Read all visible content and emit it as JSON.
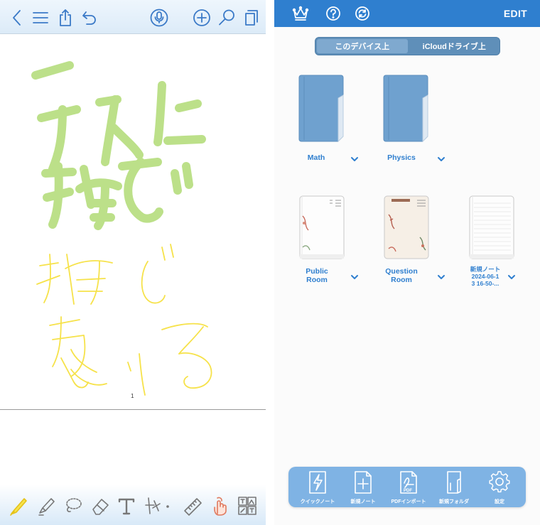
{
  "editor": {
    "toolbar_icons": [
      "back-chevron-icon",
      "menu-icon",
      "share-icon",
      "undo-icon",
      "microphone-icon",
      "add-icon",
      "search-icon",
      "pages-icon"
    ],
    "page_number": "1",
    "handwriting_colors": {
      "highlighter": "#b5dd7d",
      "pen": "#f6e24a"
    },
    "pen_tools": [
      "highlighter-icon",
      "marker-icon",
      "lasso-icon",
      "eraser-icon",
      "text-tool-icon",
      "laser-pointer-icon",
      "ruler-icon",
      "hand-tool-icon",
      "layout-icon"
    ]
  },
  "library": {
    "header": {
      "edit_label": "EDIT",
      "icons": [
        "crown-icon",
        "help-icon",
        "sync-icon"
      ]
    },
    "tabs": [
      {
        "label": "このデバイス上",
        "active": true
      },
      {
        "label": "iCloudドライブ上",
        "active": false
      }
    ],
    "folders": [
      {
        "name": "Math"
      },
      {
        "name": "Physics"
      }
    ],
    "notebooks": [
      {
        "name": "Public Room",
        "line1": "Public",
        "line2": "Room"
      },
      {
        "name": "Question Room",
        "line1": "Question",
        "line2": "Room"
      },
      {
        "name": "新規ノート 2024-06-13 16-50-...",
        "line1": "新規ノート",
        "line2": "2024-06-1",
        "line3": "3 16-50-..."
      }
    ],
    "bottom_bar": [
      {
        "label": "クイックノート",
        "icon": "quick-note-icon"
      },
      {
        "label": "新規ノート",
        "icon": "new-note-icon"
      },
      {
        "label": "PDFインポート",
        "icon": "pdf-import-icon"
      },
      {
        "label": "新規フォルダ",
        "icon": "new-folder-icon"
      },
      {
        "label": "設定",
        "icon": "settings-icon"
      }
    ],
    "colors": {
      "accent": "#2f7fcf",
      "folder": "#6fa1cf",
      "bottom_bar": "#7fb3e4"
    }
  }
}
